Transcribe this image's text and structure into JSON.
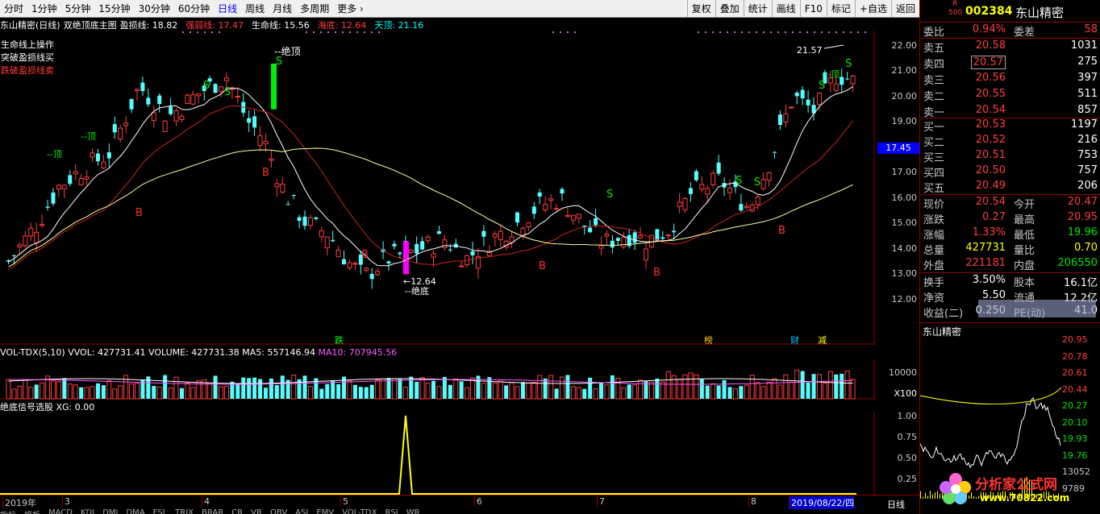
{
  "toolbar": {
    "periods": [
      "分时",
      "1分钟",
      "5分钟",
      "15分钟",
      "30分钟",
      "60分钟",
      "日线",
      "周线",
      "月线",
      "多周期",
      "更多 ›"
    ],
    "active": "日线",
    "tools": [
      "复权",
      "叠加",
      "统计",
      "画线",
      "F10",
      "标记",
      "+自选",
      "返回"
    ]
  },
  "main_header": {
    "stock": "东山精密(日线)",
    "indicator": "双绝顶底主图",
    "items": [
      {
        "label": "盈损线: 18.82",
        "color": "#ffffff"
      },
      {
        "label": "强弱线: 17.47",
        "color": "#ff3c3c"
      },
      {
        "label": "生命线: 15.56",
        "color": "#ffffff"
      },
      {
        "label": "海底: 12.64",
        "color": "#ff3c3c"
      },
      {
        "label": "天顶: 21.16",
        "color": "#00ffff"
      }
    ]
  },
  "ops": [
    {
      "text": "生命线上操作",
      "color": "#ffffff"
    },
    {
      "text": "突破盈损线买",
      "color": "#ffffff"
    },
    {
      "text": "跌破盈损线卖",
      "color": "#ff3c3c"
    }
  ],
  "price_axis": [
    "22.00",
    "21.00",
    "20.00",
    "19.00",
    "18.00",
    "17.00",
    "16.00",
    "15.00",
    "14.00",
    "13.00",
    "12.00"
  ],
  "current_price_tag": "17.45",
  "annotations": {
    "top_peak": "--绝顶",
    "bottom_low_value": "12.64",
    "bottom_low": "--绝底",
    "high_value": "21.57",
    "ding": "--顶",
    "buy": "B",
    "sell": "S",
    "events": [
      {
        "text": "跌",
        "color": "#00ff00"
      },
      {
        "text": "榜",
        "color": "#ffcc00"
      },
      {
        "text": "财",
        "color": "#00ccff"
      },
      {
        "text": "减",
        "color": "#ffff00"
      }
    ]
  },
  "vol_header": {
    "name": "VOL-TDX(5,10)",
    "vvol": "VVOL: 427731.41",
    "volume": "VOLUME: 427731.38",
    "ma5": "MA5: 557146.94",
    "ma10": "MA10: 707945.56"
  },
  "vol_axis": [
    "10000",
    "X100"
  ],
  "sig_header": {
    "name": "绝底信号选股",
    "xg": "XG: 0.00"
  },
  "sig_axis": [
    "1.00",
    "0.75",
    "0.50",
    "0.25"
  ],
  "date_axis": [
    "2019年",
    "3",
    "4",
    "5",
    "6",
    "7",
    "8",
    "2019/08/22/四"
  ],
  "date_period": "日线",
  "bottom_tabs": [
    "指标",
    "模板",
    "MACD",
    "KDJ",
    "DMI",
    "DMA",
    "FSL",
    "TRIX",
    "BRAR",
    "CR",
    "VR",
    "OBV",
    "ASI",
    "EMV",
    "VOL-TDX",
    "RSI",
    "WR"
  ],
  "quote": {
    "code": "002384",
    "name": "东山精密",
    "r_tag": "R",
    "r_num": "500",
    "weibi": {
      "label": "委比",
      "value": "0.94%",
      "label2": "委差",
      "value2": "58"
    },
    "asks": [
      {
        "label": "卖五",
        "price": "20.58",
        "vol": "1031"
      },
      {
        "label": "卖四",
        "price": "20.57",
        "vol": "275"
      },
      {
        "label": "卖三",
        "price": "20.56",
        "vol": "397"
      },
      {
        "label": "卖二",
        "price": "20.55",
        "vol": "511"
      },
      {
        "label": "卖一",
        "price": "20.54",
        "vol": "857"
      }
    ],
    "bids": [
      {
        "label": "买一",
        "price": "20.53",
        "vol": "1197"
      },
      {
        "label": "买二",
        "price": "20.52",
        "vol": "216"
      },
      {
        "label": "买三",
        "price": "20.51",
        "vol": "753"
      },
      {
        "label": "买四",
        "price": "20.50",
        "vol": "757"
      },
      {
        "label": "买五",
        "price": "20.49",
        "vol": "206"
      }
    ],
    "stats": [
      {
        "l1": "现价",
        "v1": "20.54",
        "c1": "red",
        "l2": "今开",
        "v2": "20.47",
        "c2": "red"
      },
      {
        "l1": "涨跌",
        "v1": "0.27",
        "c1": "red",
        "l2": "最高",
        "v2": "20.95",
        "c2": "red"
      },
      {
        "l1": "涨幅",
        "v1": "1.33%",
        "c1": "red",
        "l2": "最低",
        "v2": "19.96",
        "c2": "green"
      },
      {
        "l1": "总量",
        "v1": "427731",
        "c1": "yellow",
        "l2": "量比",
        "v2": "0.70",
        "c2": "yellow"
      },
      {
        "l1": "外盘",
        "v1": "221181",
        "c1": "red",
        "l2": "内盘",
        "v2": "206550",
        "c2": "green"
      }
    ],
    "stats2": [
      {
        "l1": "换手",
        "v1": "3.50%",
        "l2": "股本",
        "v2": "16.1亿"
      },
      {
        "l1": "净资",
        "v1": "5.50",
        "l2": "流通",
        "v2": "12.2亿"
      },
      {
        "l1": "收益(二)",
        "v1": "0.250",
        "l2": "PE(动)",
        "v2": "41.0"
      }
    ]
  },
  "mini": {
    "title": "东山精密",
    "axis": [
      "20.95",
      "20.78",
      "20.61",
      "20.44",
      "20.27",
      "20.10",
      "19.93",
      "19.76",
      "13052",
      "9789"
    ]
  },
  "watermark": {
    "line1": "分析家公式网",
    "line2": "www.70822.com"
  },
  "colors": {
    "up": "#ff3c3c",
    "down": "#54ffff",
    "bg": "#000000",
    "grid": "#8b0000"
  }
}
